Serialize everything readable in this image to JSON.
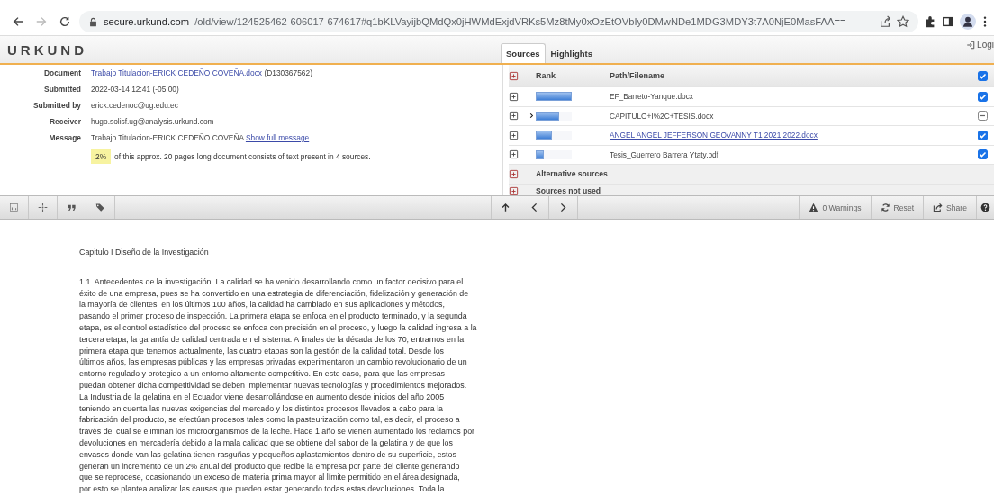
{
  "browser": {
    "url_host": "secure.urkund.com",
    "url_path": "/old/view/124525462-606017-674617#q1bKLVayijbQMdQx0jHWMdExjdVRKs5Mz8tMy0xOzEtOVbIy0DMwNDe1MDG3MDY3t7A0NjE0MasFAA==",
    "forward_disabled": true
  },
  "app": {
    "logo": "URKUND",
    "login": "Logi"
  },
  "document_info": {
    "fields": [
      {
        "label": "Document",
        "value": "Trabajo Titulacion-ERICK CEDEÑO COVEÑA.docx",
        "link": true,
        "suffix": "(D130367562)"
      },
      {
        "label": "Submitted",
        "value": "2022-03-14 12:41 (-05:00)",
        "link": false
      },
      {
        "label": "Submitted by",
        "value": "erick.cedenoc@ug.edu.ec",
        "link": false
      },
      {
        "label": "Receiver",
        "value": "hugo.solisf.ug@analysis.urkund.com",
        "link": false
      },
      {
        "label": "Message",
        "value": "Trabajo Titulacion-ERICK CEDEÑO COVEÑA",
        "link": false,
        "action": "Show full message"
      }
    ],
    "percent": "2%",
    "summary": "of this approx. 20 pages long document consists of text present in 4 sources."
  },
  "tabs": [
    {
      "label": "Sources",
      "selected": true
    },
    {
      "label": "Highlights",
      "selected": false
    }
  ],
  "sources": {
    "columns": [
      "Rank",
      "Path/Filename"
    ],
    "all_checked": true,
    "rows": [
      {
        "level": 1.0,
        "name": "EF_Barreto-Yanque.docx",
        "link": false,
        "collapsible": false,
        "checked": true,
        "partial": false
      },
      {
        "level": 0.65,
        "name": "CAPITULO+I%2C+TESIS.docx",
        "link": false,
        "collapsible": true,
        "checked": false,
        "partial": true
      },
      {
        "level": 0.45,
        "name": "ANGEL ANGEL JEFFERSON GEOVANNY T1 2021 2022.docx",
        "link": true,
        "collapsible": false,
        "checked": true,
        "partial": false
      },
      {
        "level": 0.22,
        "name": "Tesis_Guerrero Barrera Ytaty.pdf",
        "link": false,
        "collapsible": false,
        "checked": true,
        "partial": false
      }
    ],
    "groups": [
      "Alternative sources",
      "Sources not used"
    ]
  },
  "toolbar": {
    "warnings": "0 Warnings",
    "reset": "Reset",
    "share": "Share"
  },
  "document": {
    "heading": "Capitulo I Diseño de la Investigación",
    "lines": [
      "1.1. Antecedentes de la investigación. La calidad se ha venido desarrollando como un factor decisivo para el",
      "éxito de una empresa, pues se ha convertido en una estrategia de diferenciación, fidelización y generación de",
      "la mayoría de clientes; en los últimos 100 años, la calidad ha cambiado en sus aplicaciones y métodos,",
      "pasando el primer proceso de inspección. La primera etapa se enfoca en el producto terminado, y la segunda",
      "etapa, es el control estadístico del proceso se enfoca con precisión en el proceso, y luego la calidad ingresa a la",
      "tercera etapa, la garantía de calidad centrada en el sistema. A finales de la década de los 70, entramos en la",
      "primera etapa que tenemos actualmente, las cuatro etapas son la gestión de la calidad total. Desde los",
      "últimos años, las empresas públicas y las empresas privadas experimentaron un cambio revolucionario de un",
      "entorno regulado y protegido a un entorno altamente competitivo. En este caso, para que las empresas",
      "puedan obtener dicha competitividad se deben implementar nuevas tecnologías y procedimientos mejorados.",
      "La Industria de la gelatina en el Ecuador viene desarrollándose en aumento desde inicios del año 2005",
      "teniendo en cuenta las nuevas exigencias del mercado y los distintos procesos llevados a cabo para la",
      "fabricación del producto, se efectúan procesos tales como la pasteurización como tal, es decir, el proceso a",
      "través del cual se eliminan los microorganismos de la leche. Hace 1 año se vienen aumentado los reclamos por",
      "devoluciones en mercadería debido a la mala calidad que se obtiene del sabor de la gelatina y de que los",
      "envases donde van las gelatina tienen rasguñas y pequeños aplastamientos dentro de su superficie, estos",
      "generan un incremento de un 2% anual del producto que recibe la empresa por parte del cliente generando",
      "que se reprocese, ocasionando un exceso de materia prima mayor al límite permitido en el área designada,",
      "por esto se plantea analizar las causas que pueden estar generando todas estas devoluciones. Toda la"
    ]
  }
}
